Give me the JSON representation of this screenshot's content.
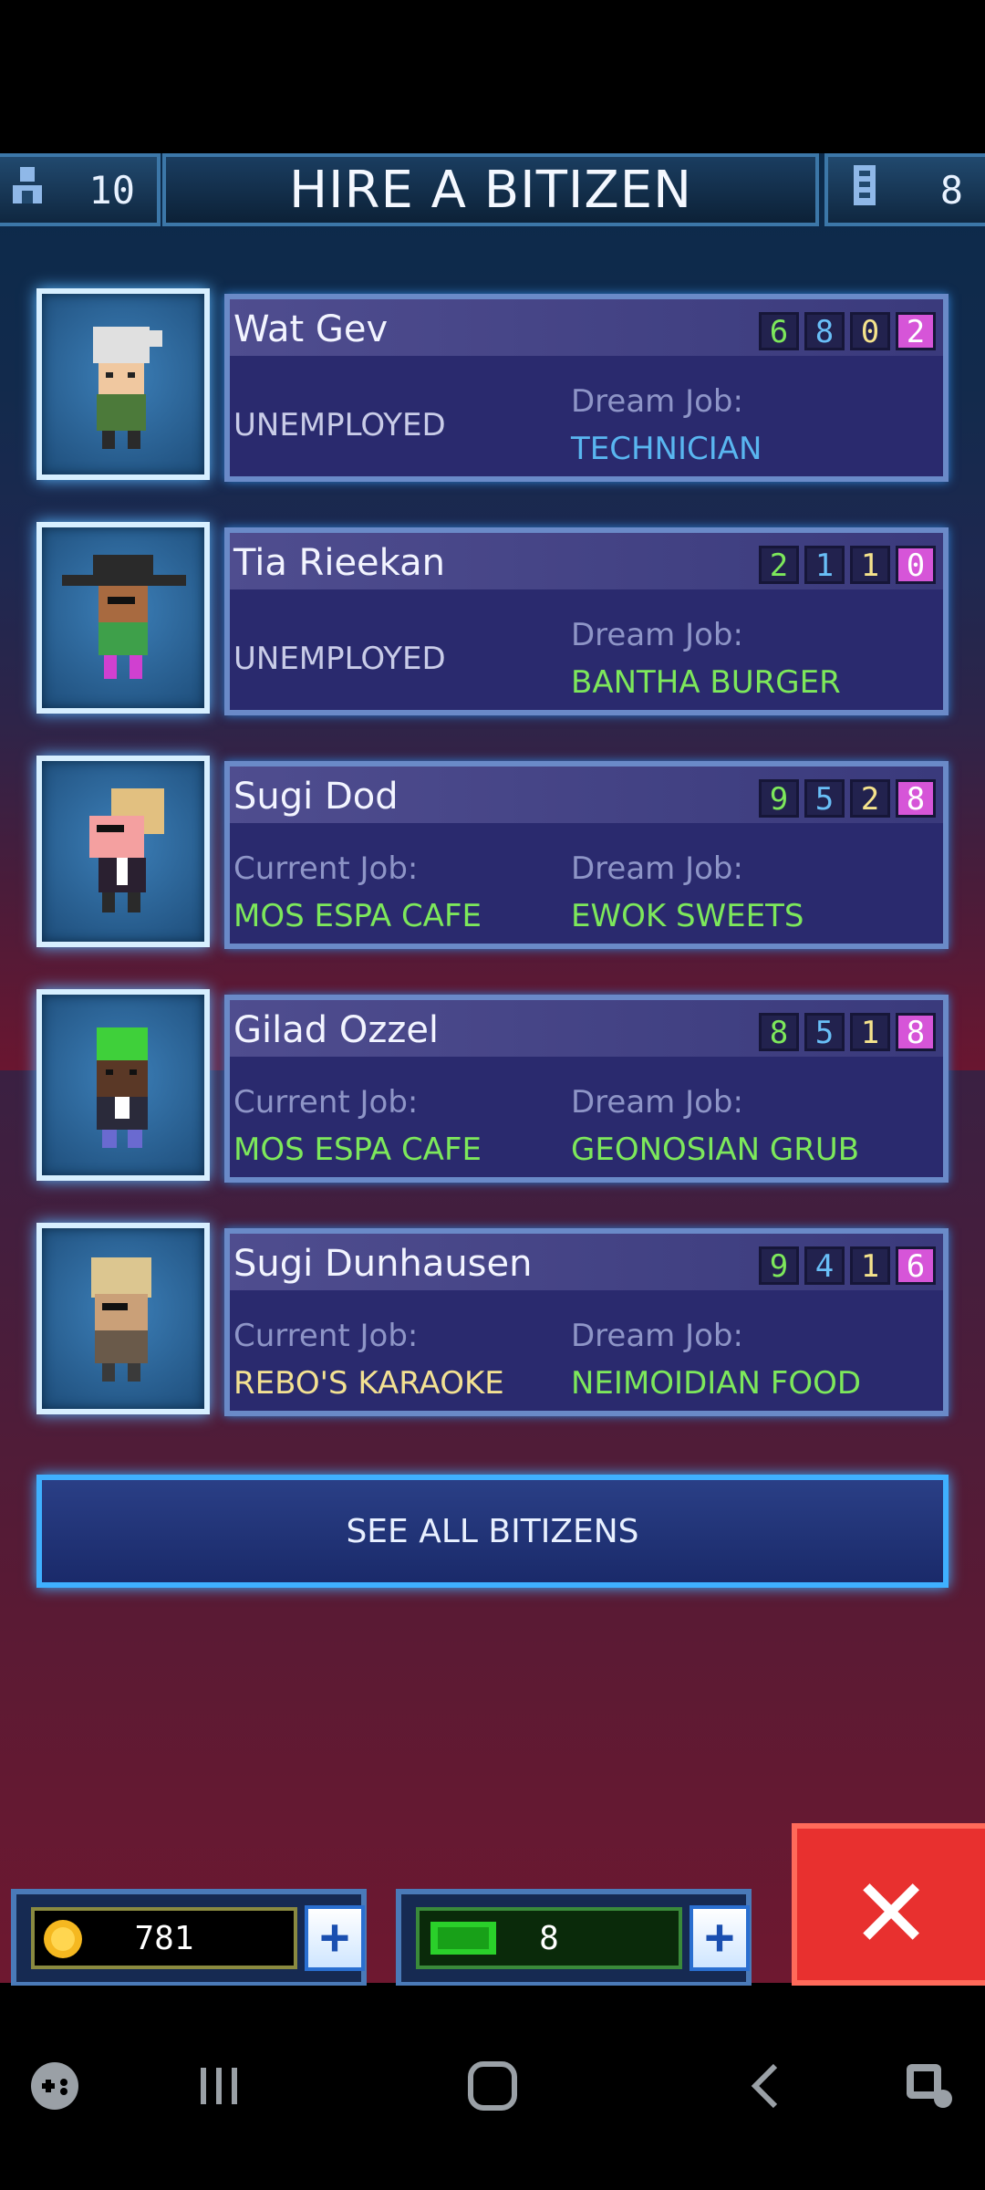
{
  "header": {
    "population": "10",
    "title": "HIRE A BITIZEN",
    "floors": "8"
  },
  "bitizens": [
    {
      "name": "Wat Gev",
      "stats": [
        "6",
        "8",
        "0",
        "2"
      ],
      "left_label": "",
      "left_value": "UNEMPLOYED",
      "dream_label": "Dream Job:",
      "dream_value": "TECHNICIAN"
    },
    {
      "name": "Tia Rieekan",
      "stats": [
        "2",
        "1",
        "1",
        "0"
      ],
      "left_label": "",
      "left_value": "UNEMPLOYED",
      "dream_label": "Dream Job:",
      "dream_value": "BANTHA BURGER"
    },
    {
      "name": "Sugi Dod",
      "stats": [
        "9",
        "5",
        "2",
        "8"
      ],
      "left_label": "Current Job:",
      "left_value": "MOS ESPA CAFE",
      "dream_label": "Dream Job:",
      "dream_value": "EWOK SWEETS"
    },
    {
      "name": "Gilad Ozzel",
      "stats": [
        "8",
        "5",
        "1",
        "8"
      ],
      "left_label": "Current Job:",
      "left_value": "MOS ESPA CAFE",
      "dream_label": "Dream Job:",
      "dream_value": "GEONOSIAN GRUB"
    },
    {
      "name": "Sugi Dunhausen",
      "stats": [
        "9",
        "4",
        "1",
        "6"
      ],
      "left_label": "Current Job:",
      "left_value": "REBO'S KARAOKE",
      "dream_label": "Dream Job:",
      "dream_value": "NEIMOIDIAN FOOD"
    }
  ],
  "see_all": "SEE ALL BITIZENS",
  "resources": {
    "coins": "781",
    "bux": "8",
    "plus": "+"
  },
  "close": "✕",
  "colors": {
    "stat1": "#7de85b",
    "stat2": "#69bff7",
    "stat3": "#f5e38c",
    "stat4": "#d655d8",
    "accent": "#3fb0ff"
  },
  "icons": [
    "person-icon",
    "floors-icon",
    "coin-icon",
    "bux-icon",
    "plus-icon",
    "close-icon",
    "game-icon",
    "recents-icon",
    "home-icon",
    "back-icon",
    "assistant-icon"
  ]
}
